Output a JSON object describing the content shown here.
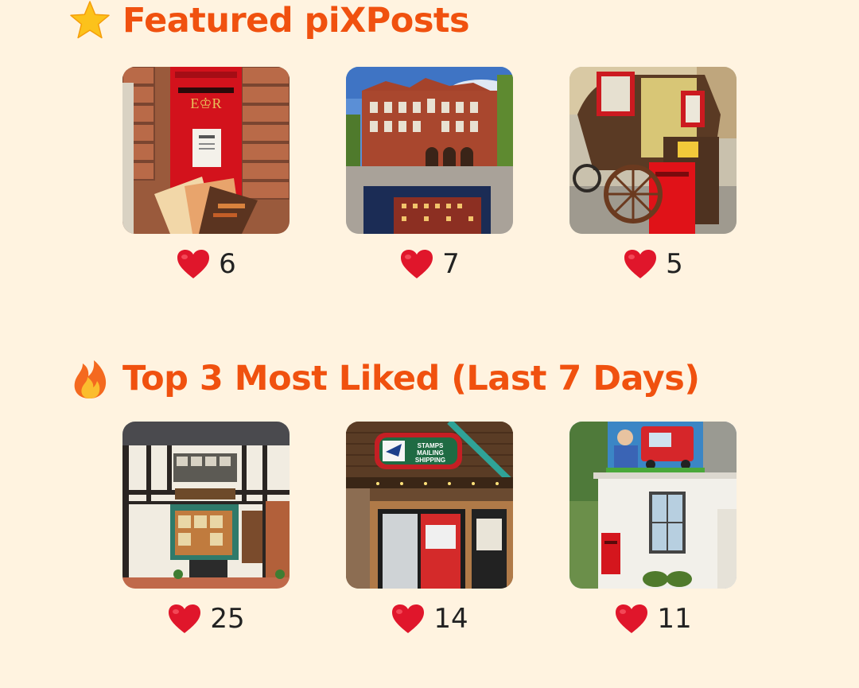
{
  "sections": {
    "featured": {
      "icon": "star-icon",
      "title": "Featured piXPosts",
      "posts": [
        {
          "likes": "6",
          "image": "red-postbox-in-brick-wall-with-postcards"
        },
        {
          "likes": "7",
          "image": "red-brick-university-building-with-photo"
        },
        {
          "likes": "5",
          "image": "stagecoach-with-red-postbox"
        }
      ]
    },
    "top_liked": {
      "icon": "fire-icon",
      "title": "Top 3 Most Liked (Last 7 Days)",
      "posts": [
        {
          "likes": "25",
          "image": "tudor-timber-frame-post-office"
        },
        {
          "likes": "14",
          "image": "usps-stamps-mailing-shipping-store"
        },
        {
          "likes": "11",
          "image": "white-cottage-with-postman-pat-van-sign"
        }
      ]
    }
  },
  "colors": {
    "background": "#fff3e0",
    "title": "#f0510f",
    "heart": "#e0162b",
    "count": "#222222"
  }
}
